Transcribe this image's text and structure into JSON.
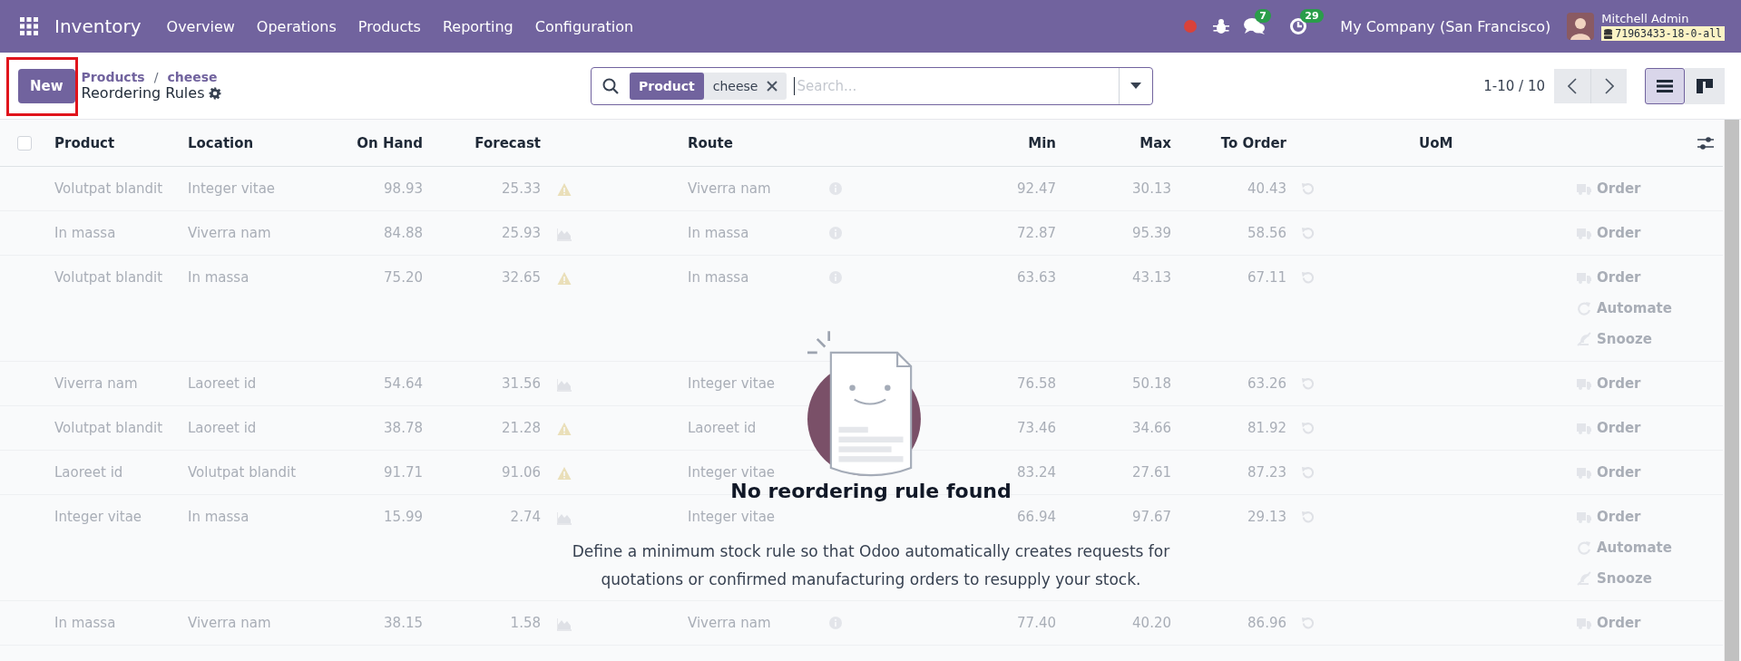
{
  "navbar": {
    "app_name": "Inventory",
    "menu": [
      "Overview",
      "Operations",
      "Products",
      "Reporting",
      "Configuration"
    ],
    "chat_badge": "7",
    "activity_badge": "29",
    "company": "My Company (San Francisco)",
    "user_name": "Mitchell Admin",
    "database": "71963433-18-0-all"
  },
  "control_panel": {
    "new_button": "New",
    "breadcrumbs": [
      "Products",
      "cheese"
    ],
    "breadcrumb_separator": "/",
    "title": "Reordering Rules",
    "search": {
      "facet_label": "Product",
      "facet_value": "cheese",
      "placeholder": "Search..."
    },
    "pager": "1-10 / 10",
    "views": [
      {
        "kind": "list",
        "selected": true
      },
      {
        "kind": "kanban",
        "selected": false
      }
    ]
  },
  "table": {
    "select_all": {
      "checked": false
    },
    "columns": [
      "Product",
      "Location",
      "On Hand",
      "Forecast",
      "Route",
      "Min",
      "Max",
      "To Order",
      "UoM"
    ],
    "rows": [
      {
        "product": "Volutpat blandit",
        "location": "Integer vitae",
        "on_hand": "98.93",
        "forecast": "25.33",
        "forecast_icon": {
          "kind": "warning"
        },
        "route": "Viverra nam",
        "route_info": true,
        "min": "92.47",
        "max": "30.13",
        "to_order": "40.43",
        "actions": [
          {
            "kind": "order",
            "label": "Order"
          }
        ]
      },
      {
        "product": "In massa",
        "location": "Viverra nam",
        "on_hand": "84.88",
        "forecast": "25.93",
        "forecast_icon": {
          "kind": "graph"
        },
        "route": "In massa",
        "route_info": true,
        "min": "72.87",
        "max": "95.39",
        "to_order": "58.56",
        "actions": [
          {
            "kind": "order",
            "label": "Order"
          }
        ]
      },
      {
        "product": "Volutpat blandit",
        "location": "In massa",
        "on_hand": "75.20",
        "forecast": "32.65",
        "forecast_icon": {
          "kind": "warning"
        },
        "route": "In massa",
        "route_info": true,
        "min": "63.63",
        "max": "43.13",
        "to_order": "67.11",
        "actions": [
          {
            "kind": "order",
            "label": "Order"
          },
          {
            "kind": "automate",
            "label": "Automate"
          },
          {
            "kind": "snooze",
            "label": "Snooze"
          }
        ]
      },
      {
        "product": "Viverra nam",
        "location": "Laoreet id",
        "on_hand": "54.64",
        "forecast": "31.56",
        "forecast_icon": {
          "kind": "graph"
        },
        "route": "Integer vitae",
        "route_info": false,
        "min": "76.58",
        "max": "50.18",
        "to_order": "63.26",
        "actions": [
          {
            "kind": "order",
            "label": "Order"
          }
        ]
      },
      {
        "product": "Volutpat blandit",
        "location": "Laoreet id",
        "on_hand": "38.78",
        "forecast": "21.28",
        "forecast_icon": {
          "kind": "warning"
        },
        "route": "Laoreet id",
        "route_info": false,
        "min": "73.46",
        "max": "34.66",
        "to_order": "81.92",
        "actions": [
          {
            "kind": "order",
            "label": "Order"
          }
        ]
      },
      {
        "product": "Laoreet id",
        "location": "Volutpat blandit",
        "on_hand": "91.71",
        "forecast": "91.06",
        "forecast_icon": {
          "kind": "warning"
        },
        "route": "Integer vitae",
        "route_info": false,
        "min": "83.24",
        "max": "27.61",
        "to_order": "87.23",
        "actions": [
          {
            "kind": "order",
            "label": "Order"
          }
        ]
      },
      {
        "product": "Integer vitae",
        "location": "In massa",
        "on_hand": "15.99",
        "forecast": "2.74",
        "forecast_icon": {
          "kind": "graph"
        },
        "route": "Integer vitae",
        "route_info": false,
        "min": "66.94",
        "max": "97.67",
        "to_order": "29.13",
        "actions": [
          {
            "kind": "order",
            "label": "Order"
          },
          {
            "kind": "automate",
            "label": "Automate"
          },
          {
            "kind": "snooze",
            "label": "Snooze"
          }
        ]
      },
      {
        "product": "In massa",
        "location": "Viverra nam",
        "on_hand": "38.15",
        "forecast": "1.58",
        "forecast_icon": {
          "kind": "graph"
        },
        "route": "Viverra nam",
        "route_info": true,
        "min": "77.40",
        "max": "40.20",
        "to_order": "86.96",
        "actions": [
          {
            "kind": "order",
            "label": "Order"
          }
        ]
      }
    ]
  },
  "empty_state": {
    "title": "No reordering rule found",
    "description": "Define a minimum stock rule so that Odoo automatically creates requests for quotations or confirmed manufacturing orders to resupply your stock."
  }
}
